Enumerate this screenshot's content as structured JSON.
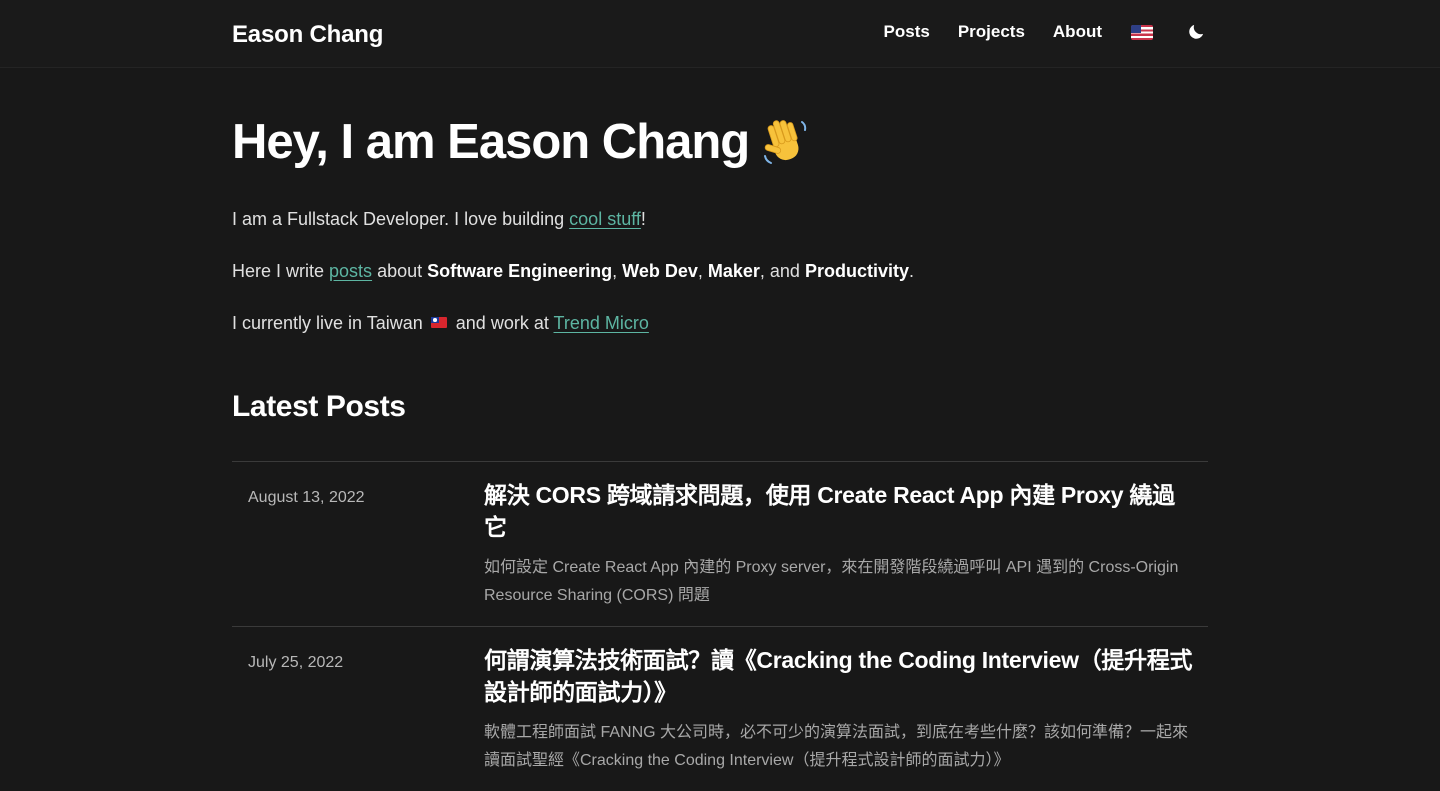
{
  "site": {
    "brand": "Eason Chang",
    "nav": {
      "posts": "Posts",
      "projects": "Projects",
      "about": "About"
    },
    "language_icon": "us-flag-icon",
    "theme_icon": "moon-icon"
  },
  "hero": {
    "title": "Hey, I am Eason Chang",
    "title_icon": "waving-hand-icon",
    "line1": {
      "before": "I am a Fullstack Developer. I love building ",
      "link": "cool stuff",
      "after": "!"
    },
    "line2": {
      "before": "Here I write ",
      "link": "posts",
      "mid": " about ",
      "topic1": "Software Engineering",
      "sep1": ", ",
      "topic2": "Web Dev",
      "sep2": ", ",
      "topic3": "Maker",
      "sep3": ", and ",
      "topic4": "Productivity",
      "end": "."
    },
    "line3": {
      "before": "I currently live in Taiwan",
      "flag_icon": "taiwan-flag-icon",
      "mid": "and work at ",
      "link": "Trend Micro"
    }
  },
  "latest": {
    "heading": "Latest Posts",
    "posts": [
      {
        "date": "August 13, 2022",
        "title": "解決 CORS 跨域請求問題，使用 Create React App 內建 Proxy 繞過它",
        "description": "如何設定 Create React App 內建的 Proxy server，來在開發階段繞過呼叫 API 遇到的 Cross-Origin Resource Sharing (CORS) 問題"
      },
      {
        "date": "July 25, 2022",
        "title": "何謂演算法技術面試？讀《Cracking the Coding Interview（提升程式設計師的面試力）》",
        "description": "軟體工程師面試 FANNG 大公司時，必不可少的演算法面試，到底在考些什麼？該如何準備？一起來讀面試聖經《Cracking the Coding Interview（提升程式設計師的面試力）》"
      }
    ]
  },
  "colors": {
    "background": "#181818",
    "link": "#5db5a2",
    "text": "#e0e0e0",
    "muted": "#a8a8a8"
  }
}
